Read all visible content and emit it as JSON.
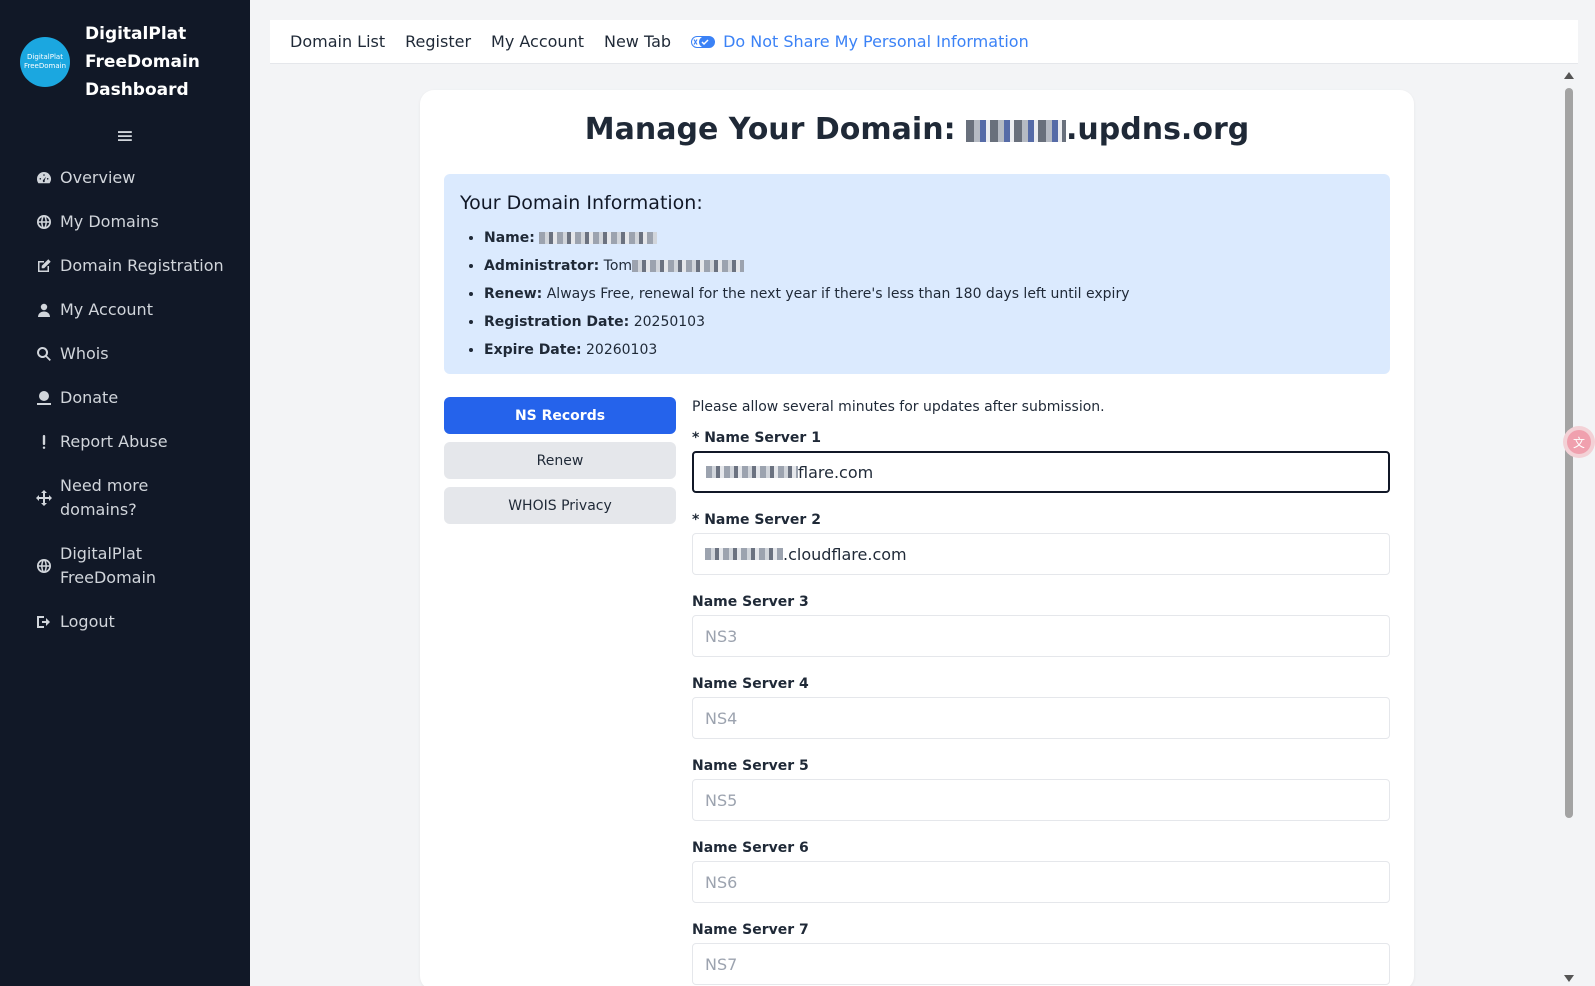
{
  "sidebar": {
    "logo_text_1": "DigitalPlat",
    "logo_text_2": "FreeDomain",
    "brand_line1": "DigitalPlat",
    "brand_line2": "FreeDomain",
    "brand_line3": "Dashboard",
    "menu_icon": "hamburger-icon",
    "items": [
      {
        "label": "Overview",
        "icon": "dashboard-gauge-icon"
      },
      {
        "label": "My Domains",
        "icon": "globe-icon"
      },
      {
        "label": "Domain Registration",
        "icon": "edit-icon"
      },
      {
        "label": "My Account",
        "icon": "user-icon"
      },
      {
        "label": "Whois",
        "icon": "search-icon"
      },
      {
        "label": "Donate",
        "icon": "donate-icon"
      },
      {
        "label": "Report Abuse",
        "icon": "exclamation-icon"
      },
      {
        "label": "Need more domains?",
        "icon": "move-arrows-icon"
      },
      {
        "label": "DigitalPlat FreeDomain",
        "icon": "globe-icon"
      },
      {
        "label": "Logout",
        "icon": "logout-icon"
      }
    ]
  },
  "topnav": {
    "links": [
      "Domain List",
      "Register",
      "My Account",
      "New Tab"
    ],
    "privacy_label": "Do Not Share My Personal Information",
    "privacy_icon": "privacy-toggle-icon"
  },
  "card": {
    "title_prefix": "Manage Your Domain: ",
    "title_suffix": ".updns.org",
    "info": {
      "heading": "Your Domain Information:",
      "name_label": "Name:",
      "admin_label": "Administrator:",
      "admin_value_start": "Tom",
      "renew_label": "Renew:",
      "renew_value": "Always Free, renewal for the next year if there's less than 180 days left until expiry",
      "reg_label": "Registration Date:",
      "reg_value": "20250103",
      "expire_label": "Expire Date:",
      "expire_value": "20260103"
    },
    "tabs": {
      "ns": "NS Records",
      "renew": "Renew",
      "whois": "WHOIS Privacy"
    },
    "notice": "Please allow several minutes for updates after submission.",
    "fields": [
      {
        "label": "* Name Server 1",
        "value_suffix": "flare.com"
      },
      {
        "label": "* Name Server 2",
        "value_suffix": ".cloudflare.com"
      },
      {
        "label": "Name Server 3",
        "placeholder": "NS3"
      },
      {
        "label": "Name Server 4",
        "placeholder": "NS4"
      },
      {
        "label": "Name Server 5",
        "placeholder": "NS5"
      },
      {
        "label": "Name Server 6",
        "placeholder": "NS6"
      },
      {
        "label": "Name Server 7",
        "placeholder": "NS7"
      }
    ]
  },
  "colors": {
    "sidebar_bg": "#111827",
    "primary": "#2563eb",
    "info_bg": "#dbeafe",
    "link": "#3b82f6",
    "logo": "#1ba7e0"
  },
  "translate_icon": "translate-icon"
}
